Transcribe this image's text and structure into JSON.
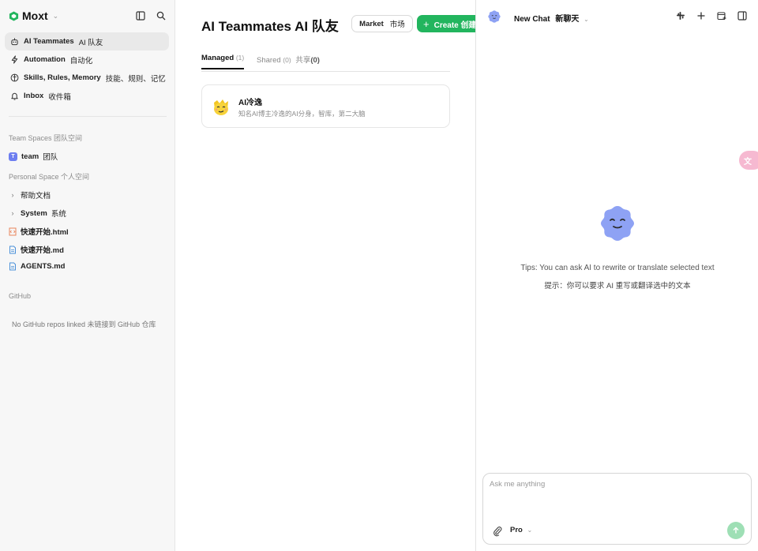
{
  "sidebar": {
    "brand": "Moxt",
    "nav": [
      {
        "en": "AI Teammates",
        "zh": "AI 队友",
        "icon": "robot-icon",
        "active": true
      },
      {
        "en": "Automation",
        "zh": "自动化",
        "icon": "lightning-icon",
        "active": false
      },
      {
        "en": "Skills, Rules, Memory",
        "zh": "技能、规则、记忆",
        "icon": "brain-icon",
        "active": false
      },
      {
        "en": "Inbox",
        "zh": "收件箱",
        "icon": "bell-icon",
        "active": false
      }
    ],
    "team_spaces_label": "Team Spaces  团队空间",
    "team": {
      "avatar": "T",
      "en": "team",
      "zh": "团队"
    },
    "personal_space_label": "Personal Space  个人空间",
    "personal_items": [
      {
        "label": "帮助文档",
        "type": "folder"
      },
      {
        "label": "System",
        "zh": "系统",
        "type": "folder"
      },
      {
        "label": "快速开始.html",
        "type": "html"
      },
      {
        "label": "快速开始.md",
        "type": "md"
      },
      {
        "label": "AGENTS.md",
        "type": "md"
      }
    ],
    "github_label": "GitHub",
    "github_empty": "No GitHub repos linked  未链接到 GitHub 仓库"
  },
  "main": {
    "title": "AI Teammates  AI 队友",
    "market_en": "Market",
    "market_zh": "市场",
    "create_label": "Create  创建",
    "tabs": {
      "managed": "Managed",
      "managed_count": "(1)",
      "shared": "Shared",
      "shared_count": "(0)",
      "shared_zh": "共享",
      "shared_zh_count": "(0)"
    },
    "card": {
      "name": "AI冷逸",
      "desc": "知名AI博主冷逸的AI分身，智库，第二大脑"
    }
  },
  "chat": {
    "title": "New Chat",
    "title_zh": "新聊天",
    "tips_en": "Tips: You can ask AI to rewrite or translate selected text",
    "tips_zh": "提示：你可以要求 AI 重写或翻译选中的文本",
    "input_placeholder": "Ask me anything",
    "model": "Pro"
  },
  "colors": {
    "accent_green": "#22b55e",
    "send_green": "#9edfb5",
    "mascot_blue": "#8ea2f4",
    "team_avatar": "#6d7ef0",
    "pill_pink": "#f6b9d1"
  }
}
